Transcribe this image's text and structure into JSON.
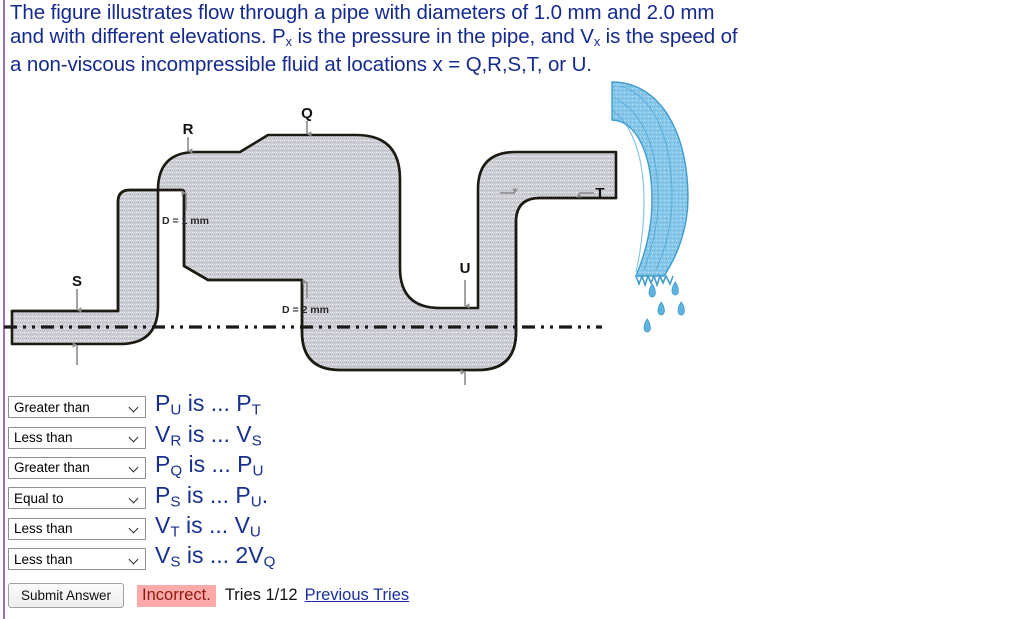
{
  "statement": {
    "line1": "The figure illustrates flow through a pipe with diameters of 1.0 mm and 2.0 mm",
    "line2_a": "and with different elevations. P",
    "line2_sub1": "x",
    "line2_b": " is the pressure in the pipe, and V",
    "line2_sub2": "x",
    "line2_c": " is the speed of",
    "line3": "a non-viscous incompressible fluid at locations x = Q,R,S,T, or U."
  },
  "figure": {
    "labels": {
      "Q": "Q",
      "R": "R",
      "S": "S",
      "T": "T",
      "U": "U"
    },
    "dim_small": "D = 1 mm",
    "dim_large": "D = 2 mm",
    "colors": {
      "pipe_fill": "#cbcbd2",
      "pipe_stroke": "#1d1a12",
      "water": "#7ec4e8",
      "water_stroke": "#2f8fc7",
      "arrow": "#8c8c8c",
      "datum": "#1a1a1a"
    }
  },
  "answers": {
    "options": [
      "Greater than",
      "Less than",
      "Equal to"
    ],
    "rows": [
      {
        "selected": "Greater than",
        "lhs": "P",
        "lhs_sub": "U",
        "mid": " is ... ",
        "rhs": "P",
        "rhs_sub": "T",
        "tail": ""
      },
      {
        "selected": "Less than",
        "lhs": "V",
        "lhs_sub": "R",
        "mid": " is ... ",
        "rhs": "V",
        "rhs_sub": "S",
        "tail": ""
      },
      {
        "selected": "Greater than",
        "lhs": "P",
        "lhs_sub": "Q",
        "mid": " is ... ",
        "rhs": "P",
        "rhs_sub": "U",
        "tail": ""
      },
      {
        "selected": "Equal to",
        "lhs": "P",
        "lhs_sub": "S",
        "mid": " is ... ",
        "rhs": "P",
        "rhs_sub": "U",
        "tail": "."
      },
      {
        "selected": "Less than",
        "lhs": "V",
        "lhs_sub": "T",
        "mid": " is ... ",
        "rhs": "V",
        "rhs_sub": "U",
        "tail": ""
      },
      {
        "selected": "Less than",
        "lhs": "V",
        "lhs_sub": "S",
        "mid": " is ... ",
        "rhs": "2V",
        "rhs_sub": "Q",
        "tail": ""
      }
    ]
  },
  "footer": {
    "submit_label": "Submit Answer",
    "status": "Incorrect.",
    "tries": "Tries 1/12",
    "previous_tries": "Previous Tries",
    "status_bg": "#ffaaaa",
    "status_color": "#8b1a10"
  }
}
